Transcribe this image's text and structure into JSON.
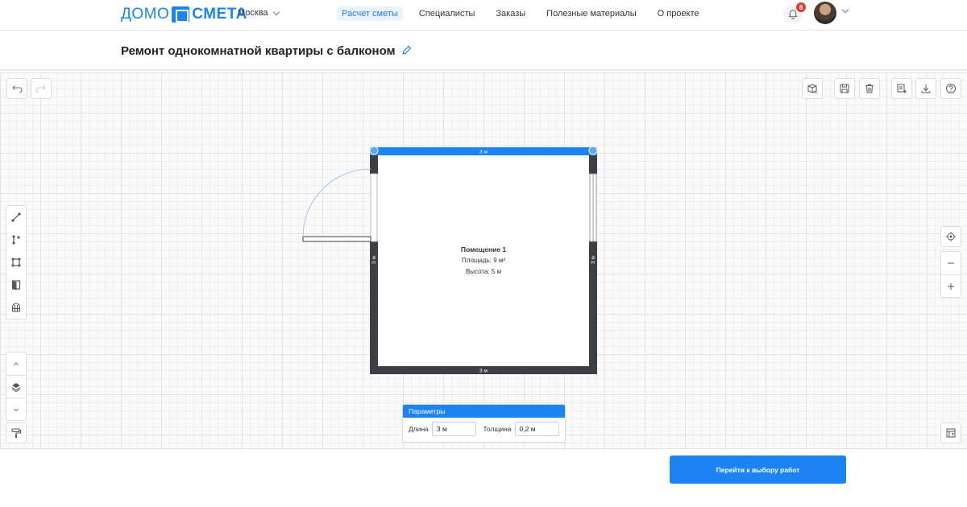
{
  "header": {
    "logo": {
      "part1": "ДОМО",
      "part2": "СМЕТА"
    },
    "city": "Москва",
    "nav": [
      "Расчет сметы",
      "Специалисты",
      "Заказы",
      "Полезные материалы",
      "О проекте"
    ],
    "active_nav": 0,
    "notifications_count": "8"
  },
  "title": "Ремонт однокомнатной квартиры с балконом",
  "room": {
    "name": "Помещение 1",
    "area": "Площадь: 9 м²",
    "height": "Высота: 5 м",
    "wall_top": "3 м",
    "wall_bottom": "3 м",
    "wall_left": "3 м",
    "wall_right": "3 м"
  },
  "params": {
    "title": "Параметры",
    "length_label": "Длина",
    "length_value": "3 м",
    "thickness_label": "Толщина",
    "thickness_value": "0,2 м"
  },
  "cta": "Перейти к выбору работ",
  "colors": {
    "accent": "#1b84f2",
    "wall": "#3c4046",
    "badge": "#e53935"
  },
  "icons": {
    "toolbar_left": [
      "draw-wall-icon",
      "add-point-icon",
      "room-shape-icon",
      "door-icon",
      "window-icon"
    ],
    "toolbar_top_right": [
      "3d-view-icon",
      "save-icon",
      "delete-icon",
      "crop-icon",
      "download-icon",
      "help-icon"
    ],
    "zoom": [
      "center-icon",
      "zoom-out-icon",
      "zoom-in-icon"
    ],
    "floor": [
      "floor-up-icon",
      "floor-icon",
      "floor-down-icon"
    ]
  }
}
